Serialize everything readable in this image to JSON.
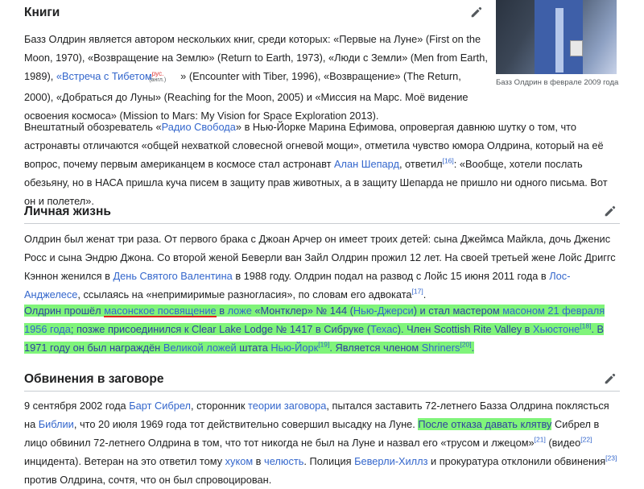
{
  "sections": {
    "books": {
      "title": "Книги"
    },
    "personal": {
      "title": "Личная жизнь"
    },
    "accusations": {
      "title": "Обвинения в заговоре"
    }
  },
  "image": {
    "caption": "Базз Олдрин в феврале 2009 года"
  },
  "books_p1": {
    "t1": "Базз Олдрин является автором нескольких книг, среди которых: «Первые на Луне» (First on the Moon, 1970), «Возвращение на Землю» (Return to Earth, 1973), «Люди с Земли» (Men from Earth, 1989),",
    "l1": "«Встреча с Тибетом",
    "lang1": "рус.",
    "lang2": "(англ.)",
    "t2": "» (Encounter with Tiber, 1996), «Возвращение» (The Return, 2000), «Добраться до Луны» (Reaching for the Moon, 2005) и «Миссия на Марс. Моё видение освоения космоса» (Mission to Mars: My Vision for Space Exploration 2013)."
  },
  "books_p2": {
    "t1": "Внештатный обозреватель «",
    "l1": "Радио Свобода",
    "t2": "» в Нью-Йорке Марина Ефимова, опровергая давнюю шутку о том, что астронавты отличаются «общей нехваткой словесной огневой мощи», отметила чувство юмора Олдрина, который на её вопрос, почему первым американцем в космосе стал астронавт ",
    "l2": "Алан Шепард",
    "t3": ", ответил",
    "ref": "[16]",
    "t4": ": «Вообще, хотели послать обезьяну, но в НАСА пришла куча писем в защиту прав животных, а в защиту Шепарда не пришло ни одного письма. Вот он и полетел»."
  },
  "personal_p1": {
    "t1": "Олдрин был женат три раза. От первого брака с Джоан Арчер он имеет троих детей: сына Джеймса Майкла, дочь Дженис Росс и сына Эндрю Джона. Со второй женой Беверли ван Зайл Олдрин прожил 12 лет. На своей третьей жене Лойс Дриггс Кэннон женился в ",
    "l1": "День Святого Валентина",
    "t2": " в 1988 году. Олдрин подал на развод с Лойс 15 июня 2011 года в ",
    "l2": "Лос-Анджелесе",
    "t3": ", ссылаясь на «непримиримые разногласия», по словам его адвоката",
    "ref": "[17]",
    "t4": "."
  },
  "personal_p2": {
    "t1": "Олдрин прошёл ",
    "l1": "масонское посвящение",
    "t2": " в ",
    "l2": "ложе",
    "t3": " «Монтклер» № 144 (",
    "l3": "Нью-Джерси",
    "t4": ") и стал мастером ",
    "l4": "масоном",
    "t5": " ",
    "l5": "21 февраля",
    "t6": " ",
    "l6": "1956 года",
    "t7": "; позже присоединился к Clear Lake Lodge № 1417 в Сибруке (",
    "l7": "Техас",
    "t8": "). Член Scottish Rite Valley в ",
    "l8": "Хьюстоне",
    "ref1": "[18]",
    "t9": ". В 1971 году он был награждён ",
    "l9": "Великой ложей",
    "t10": " штата ",
    "l10": "Нью-Йорк",
    "ref2": "[19]",
    "t11": ". Является членом ",
    "l11": "Shriners",
    "ref3": "[20]",
    "t12": "."
  },
  "acc_p1": {
    "t1": "9 сентября 2002 года ",
    "l1": "Барт Сибрел",
    "t2": ", сторонник ",
    "l2": "теории заговора",
    "t3": ", пытался заставить 72-летнего Базза Олдрина поклясться на ",
    "l3": "Библии",
    "t4": ", что 20 июля 1969 года тот действительно совершил высадку на Луне. ",
    "hl": "После отказа давать клятву",
    "t5": " Сибрел в лицо обвинил 72-летнего Олдрина в том, что тот никогда не был на Луне и назвал его «трусом и лжецом»",
    "ref1": "[21]",
    "t6": " (видео",
    "ref2": "[22]",
    "t7": " инцидента). Ветеран на это ответил тому ",
    "l4": "хуком",
    "t8": " в ",
    "l5": "челюсть",
    "t9": ". Полиция ",
    "l6": "Беверли-Хиллз",
    "t10": " и прокуратура отклонили обвинения",
    "ref3": "[23]",
    "t11": " против Олдрина, сочтя, что он был спровоцирован."
  }
}
